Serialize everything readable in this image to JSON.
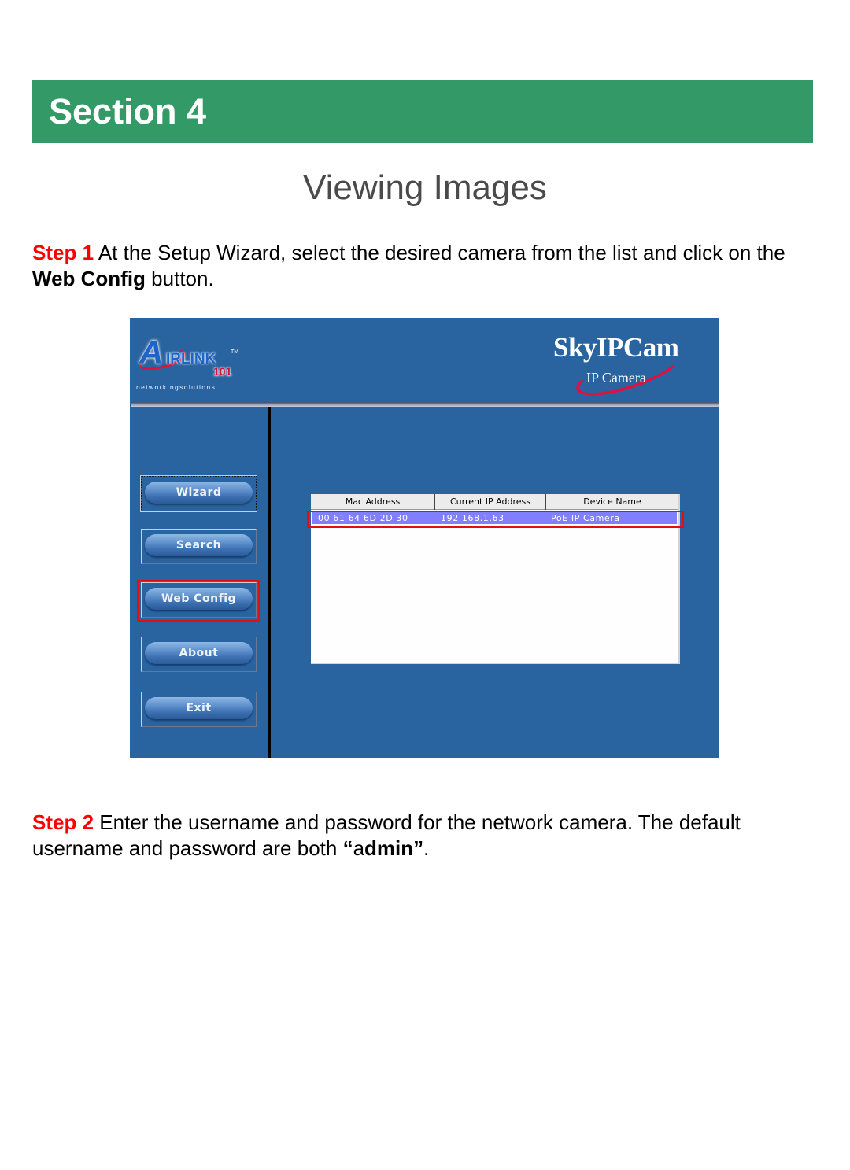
{
  "section": {
    "label": "Section 4",
    "color": "#339966"
  },
  "page_title": "Viewing Images",
  "steps": [
    {
      "label": "Step 1",
      "text_before": " At the Setup Wizard, select the desired camera from the list and click on the ",
      "bold": "Web Config",
      "text_after": " button."
    },
    {
      "label": "Step 2",
      "text_before": " Enter the username and password for the network camera. The default username and password are both ",
      "quote_open": "“",
      "plain_a": "a",
      "bold": "dmin",
      "quote_close": "”",
      "text_after": "."
    }
  ],
  "app": {
    "background_color": "#2964a0",
    "logo_left": {
      "letter": "A",
      "wordmark": "IRLINK",
      "trademark": "TM",
      "number": "101",
      "tagline": "networkingsolutions"
    },
    "logo_right": {
      "brand": "SkyIPCam",
      "subtitle": "IP Camera"
    },
    "nav_buttons": [
      {
        "label": "Wizard",
        "focused": true
      },
      {
        "label": "Search"
      },
      {
        "label": "Web Config",
        "highlighted": true
      },
      {
        "label": "About"
      },
      {
        "label": "Exit"
      }
    ],
    "camera_list": {
      "columns": [
        "Mac Address",
        "Current IP Address",
        "Device Name"
      ],
      "rows": [
        {
          "mac": "00 61 64 6D 2D 30",
          "ip": "192.168.1.63",
          "name": "PoE IP Camera",
          "selected": true
        }
      ],
      "selection_color": "#8080ff"
    },
    "highlight_color": "#e01010"
  }
}
